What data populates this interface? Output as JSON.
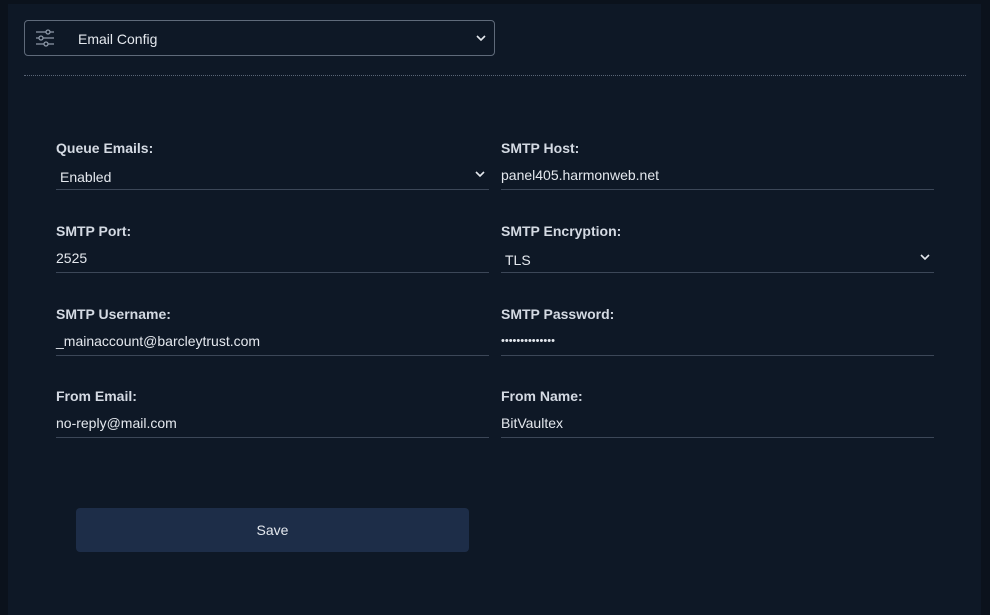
{
  "config_selector": {
    "selected": "Email Config",
    "icon": "sliders-icon"
  },
  "form": {
    "queue_emails": {
      "label": "Queue Emails:",
      "value": "Enabled"
    },
    "smtp_host": {
      "label": "SMTP Host:",
      "value": "panel405.harmonweb.net"
    },
    "smtp_port": {
      "label": "SMTP Port:",
      "value": "2525"
    },
    "smtp_encryption": {
      "label": "SMTP Encryption:",
      "value": "TLS"
    },
    "smtp_username": {
      "label": "SMTP Username:",
      "value": "_mainaccount@barcleytrust.com"
    },
    "smtp_password": {
      "label": "SMTP Password:",
      "value": "••••••••••••••"
    },
    "from_email": {
      "label": "From Email:",
      "value": "no-reply@mail.com"
    },
    "from_name": {
      "label": "From Name:",
      "value": "BitVaultex"
    }
  },
  "actions": {
    "save_label": "Save"
  },
  "colors": {
    "background": "#0e1826",
    "button": "#1d2d48",
    "text": "#d4dae3"
  }
}
